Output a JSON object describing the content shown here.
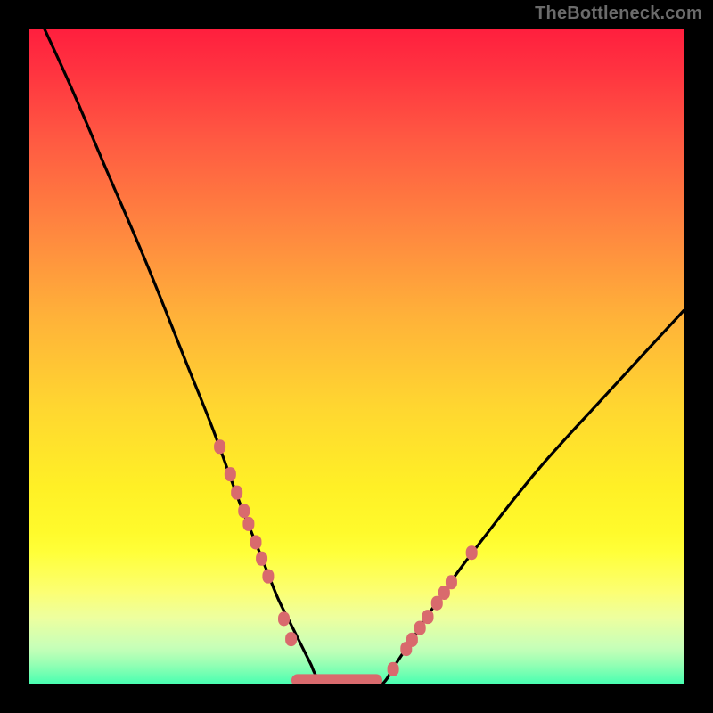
{
  "watermark": "TheBottleneck.com",
  "colors": {
    "frame": "#000000",
    "curve": "#000000",
    "markers": "#d96a6d"
  },
  "chart_data": {
    "type": "line",
    "title": "",
    "xlabel": "",
    "ylabel": "",
    "xlim": [
      0,
      100
    ],
    "ylim": [
      0,
      100
    ],
    "curve": {
      "x": [
        0,
        6,
        12,
        18,
        24,
        28,
        32,
        34,
        36,
        38,
        40,
        42,
        43,
        44,
        46,
        48,
        50,
        52,
        54,
        56,
        58,
        60,
        64,
        70,
        78,
        88,
        100
      ],
      "y": [
        105,
        92,
        78,
        64,
        49,
        39,
        28,
        23,
        18,
        13,
        9,
        5,
        3,
        1,
        0,
        0,
        0,
        0,
        0,
        3,
        6,
        9,
        15,
        23,
        33,
        44,
        57
      ]
    },
    "markers_left": {
      "x": [
        29.1,
        30.7,
        31.7,
        32.8,
        33.5,
        34.6,
        35.5,
        36.5,
        38.9,
        40.0
      ],
      "y": [
        36.2,
        32.0,
        29.2,
        26.4,
        24.4,
        21.6,
        19.1,
        16.4,
        9.9,
        6.8
      ]
    },
    "markers_right": {
      "x": [
        55.6,
        57.6,
        58.5,
        59.7,
        60.9,
        62.3,
        63.4,
        64.5,
        67.6
      ],
      "y": [
        2.2,
        5.3,
        6.7,
        8.5,
        10.2,
        12.3,
        13.9,
        15.5,
        20.0
      ]
    },
    "flat_bar": {
      "x_start": 41,
      "x_end": 53,
      "y": 0.5
    }
  }
}
